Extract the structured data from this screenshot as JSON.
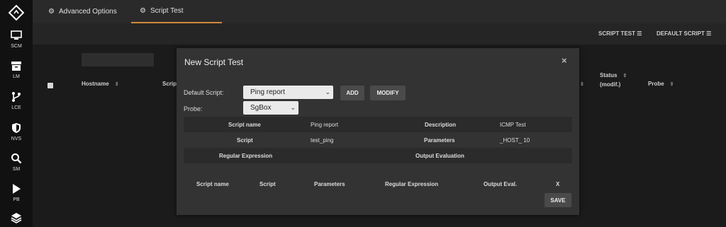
{
  "sidebar": {
    "items": [
      {
        "label": "SCM",
        "icon": "monitor-icon"
      },
      {
        "label": "LM",
        "icon": "archive-icon"
      },
      {
        "label": "LCE",
        "icon": "branch-icon"
      },
      {
        "label": "NVS",
        "icon": "shield-icon"
      },
      {
        "label": "SM",
        "icon": "search-icon"
      },
      {
        "label": "PB",
        "icon": "play-icon"
      },
      {
        "label": "",
        "icon": "layers-icon"
      }
    ]
  },
  "tabs": [
    {
      "label": "Advanced Options",
      "icon": "gear-icon"
    },
    {
      "label": "Script Test",
      "icon": "gears-icon"
    }
  ],
  "toolbar": {
    "script_test": "SCRIPT TEST",
    "default_script": "DEFAULT SCRIPT"
  },
  "table": {
    "headers": {
      "hostname": "Hostname",
      "script": "Scrip",
      "status_line1": "Status",
      "status_line2": "(modif.)",
      "probe": "Probe"
    }
  },
  "modal": {
    "title": "New Script Test",
    "close": "×",
    "default_script_label": "Default Script:",
    "default_script_value": "Ping report",
    "add_label": "ADD",
    "modify_label": "MODIFY",
    "probe_label": "Probe:",
    "probe_value": "SgBox",
    "details": {
      "script_name_label": "Script name",
      "script_name_value": "Ping report",
      "description_label": "Description",
      "description_value": "ICMP Test",
      "script_label": "Script",
      "script_value": "test_ping",
      "parameters_label": "Parameters",
      "parameters_value": "_HOST_ 10",
      "regex_label": "Regular Expression",
      "output_eval_label": "Output Evaluation"
    },
    "list_headers": [
      "Script name",
      "Script",
      "Parameters",
      "Regular Expression",
      "Output Eval.",
      "X"
    ],
    "save_label": "SAVE"
  }
}
